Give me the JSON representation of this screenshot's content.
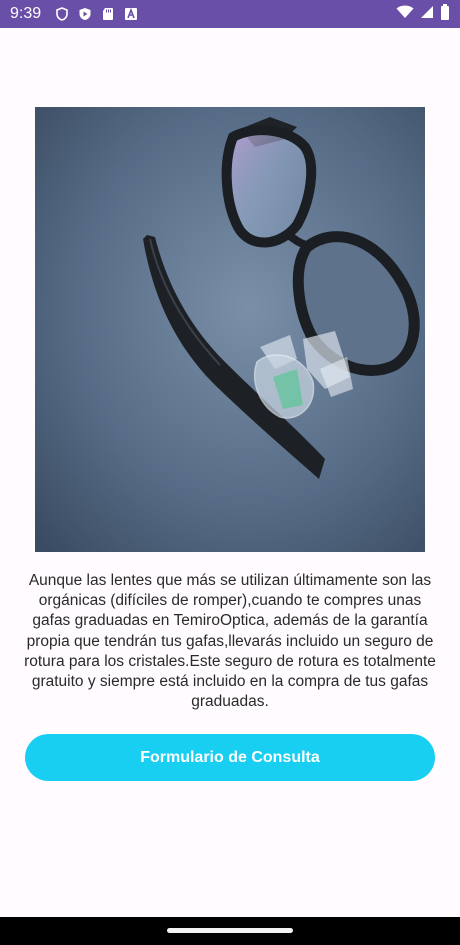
{
  "status_bar": {
    "time": "9:39",
    "left_icons": [
      "shield-icon",
      "play-protect-icon",
      "sd-card-icon",
      "font-a-icon"
    ],
    "right_icons": [
      "wifi-icon",
      "signal-icon",
      "battery-icon"
    ],
    "background_color": "#6a4fa8"
  },
  "content": {
    "image_description_icon": "broken-glasses-photo",
    "paragraph": "Aunque las lentes que más se utilizan últimamente son las orgánicas (difíciles de romper),cuando te compres unas gafas graduadas en TemiroOptica, además de la garantía propia que tendrán tus gafas,llevarás incluido un seguro de rotura para los cristales.Este seguro de rotura es totalmente gratuito y siempre está incluido en la compra de tus gafas graduadas.",
    "button_label": "Formulario de Consulta",
    "button_color": "#18cff1"
  }
}
